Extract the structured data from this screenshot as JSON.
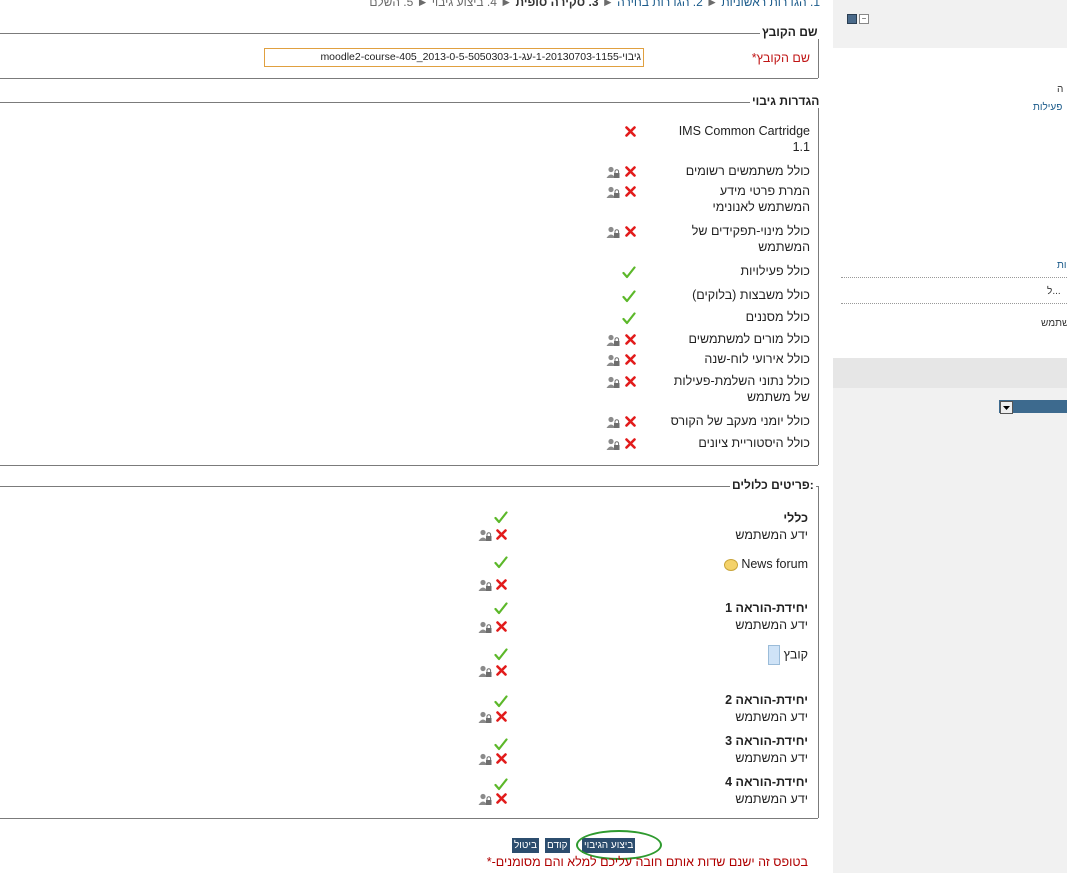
{
  "breadcrumb": {
    "steps": [
      "1. הגדרות ראשוניות",
      "2. הגדרות בחירה",
      "3. סקירה סופית",
      "4. ביצוע גיבוי",
      "5. השלם"
    ],
    "separator": "►"
  },
  "filename_section": {
    "legend": "שם הקובץ",
    "label": "שם הקובץ",
    "required_mark": "*",
    "value": "גיבוי-1-20130703-1155-עג-moodle2-course-405_2013-0-5-5050303-1"
  },
  "backup_settings": {
    "legend": "הגדרות גיבוי",
    "items": [
      {
        "label": "IMS Common Cartridge 1.1",
        "state": "no",
        "locked": false
      },
      {
        "label": "כולל משתמשים רשומים",
        "state": "no",
        "locked": true
      },
      {
        "label": "המרת פרטי מידע המשתמש לאנונימי",
        "state": "no",
        "locked": true
      },
      {
        "label": "כולל מינוי-תפקידים של המשתמש",
        "state": "no",
        "locked": true
      },
      {
        "label": "כולל פעילויות",
        "state": "yes",
        "locked": false
      },
      {
        "label": "כולל משבצות (בלוקים)",
        "state": "yes",
        "locked": false
      },
      {
        "label": "כולל מסננים",
        "state": "yes",
        "locked": false
      },
      {
        "label": "כולל מורים למשתמשים",
        "state": "no",
        "locked": true
      },
      {
        "label": "כולל אירועי לוח-שנה",
        "state": "no",
        "locked": true
      },
      {
        "label": "כולל נתוני השלמת-פעילות של משתמש",
        "state": "no",
        "locked": true
      },
      {
        "label": "כולל יומני מעקב של הקורס",
        "state": "no",
        "locked": true
      },
      {
        "label": "כולל היסטוריית ציונים",
        "state": "no",
        "locked": true
      }
    ]
  },
  "included_items": {
    "legend": "פריטים כלולים:",
    "rows": [
      {
        "title": "כללי",
        "sub": "ידע המשתמש"
      },
      {
        "title": "News forum",
        "sub": ""
      },
      {
        "title": "יחידת-הוראה 1",
        "sub": "ידע המשתמש"
      },
      {
        "title": "קובץ",
        "sub": ""
      },
      {
        "title": "יחידת-הוראה 2",
        "sub": "ידע המשתמש"
      },
      {
        "title": "יחידת-הוראה 3",
        "sub": "ידע המשתמש"
      },
      {
        "title": "יחידת-הוראה 4",
        "sub": "ידע המשתמש"
      }
    ]
  },
  "buttons": {
    "perform_backup": "ביצוע הגיבוי",
    "previous": "קודם",
    "cancel": "ביטול"
  },
  "required_note": "בטופס זה ישנם שדות אותם חובה עליכם למלא והם מסומנים-*",
  "side_panel": {
    "text_a": "ה",
    "link_activities": "פעילות",
    "link_b": "ות",
    "text_c": "ל...",
    "text_d": "שתמש"
  },
  "colors": {
    "x": "#e21b1b",
    "check": "#5cb82a",
    "button": "#2c4d6e",
    "highlight_oval": "#2e9a2e",
    "required": "#b00000"
  }
}
